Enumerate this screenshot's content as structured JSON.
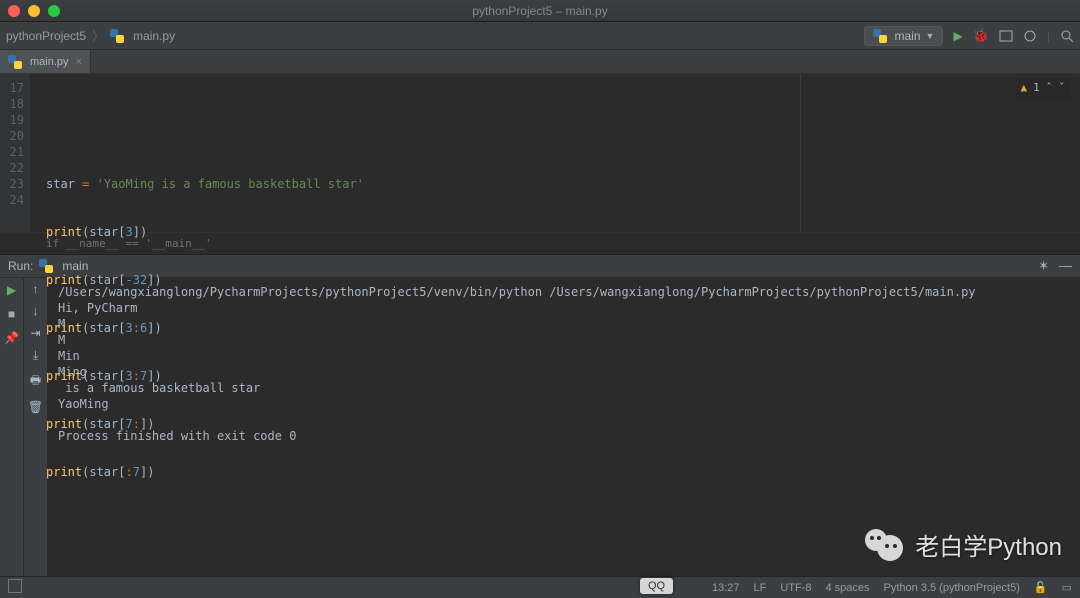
{
  "window": {
    "title": "pythonProject5 – main.py"
  },
  "breadcrumb": {
    "project": "pythonProject5",
    "file": "main.py"
  },
  "toolbar": {
    "run_config": "main"
  },
  "tabs": [
    {
      "label": "main.py"
    }
  ],
  "editor": {
    "lines": [
      17,
      18,
      19,
      20,
      21,
      22,
      23,
      24
    ],
    "code": {
      "l18_var": "star",
      "l18_eq": " = ",
      "l18_str": "'YaoMing is a famous basketball star'",
      "print": "print",
      "star_id": "star",
      "l19_num": "3",
      "l20_num": "-32",
      "l21_a": "3",
      "l21_b": "6",
      "l22_a": "3",
      "l22_b": "7",
      "l23_a": "7",
      "l24_b": "7",
      "open": "(",
      "close": ")",
      "lb": "[",
      "rb": "]",
      "colon": ":"
    },
    "breadcrumb_bottom": "if __name__ == '__main__'",
    "warning_count": "1"
  },
  "run": {
    "label": "Run:",
    "tab": "main",
    "output": [
      "/Users/wangxianglong/PycharmProjects/pythonProject5/venv/bin/python /Users/wangxianglong/PycharmProjects/pythonProject5/main.py",
      "Hi, PyCharm",
      "M",
      "M",
      "Min",
      "Ming",
      " is a famous basketball star",
      "YaoMing",
      "",
      "Process finished with exit code 0"
    ]
  },
  "status": {
    "caret": "13:27",
    "lf": "LF",
    "enc": "UTF-8",
    "indent": "4 spaces",
    "interpreter": "Python 3.5 (pythonProject5)"
  },
  "dock": {
    "tip": "QQ"
  },
  "watermark": {
    "text": "老白学Python"
  }
}
